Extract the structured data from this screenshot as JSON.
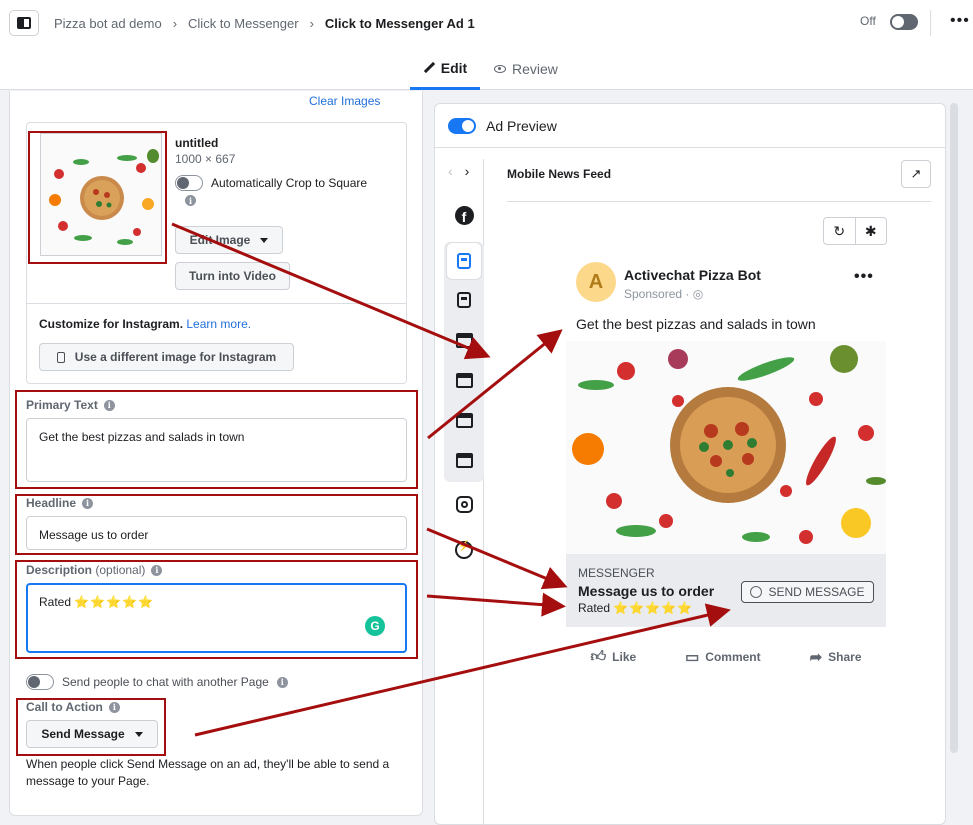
{
  "header": {
    "breadcrumbs": [
      "Pizza bot ad demo",
      "Click to Messenger",
      "Click to Messenger Ad 1"
    ],
    "status_label": "Off",
    "more_icon": "more-horizontal-icon"
  },
  "tabs": [
    {
      "label": "Edit",
      "icon": "pencil-icon",
      "active": true
    },
    {
      "label": "Review",
      "icon": "eye-icon",
      "active": false
    }
  ],
  "editor": {
    "clear_images": "Clear Images",
    "image": {
      "name": "untitled",
      "dimensions": "1000 × 667",
      "crop_label": "Automatically Crop to Square",
      "edit_button": "Edit Image",
      "video_button": "Turn into Video"
    },
    "instagram": {
      "title": "Customize for Instagram.",
      "link": "Learn more.",
      "button": "Use a different image for Instagram"
    },
    "primary_text": {
      "label": "Primary Text",
      "value": "Get the best pizzas and salads in town"
    },
    "headline": {
      "label": "Headline",
      "value": "Message us to order"
    },
    "description": {
      "label": "Description",
      "optional": "(optional)",
      "value": "Rated",
      "stars": "⭐⭐⭐⭐⭐"
    },
    "chat_toggle_label": "Send people to chat with another Page",
    "cta": {
      "label": "Call to Action",
      "value": "Send Message",
      "help": "When people click Send Message on an ad, they'll be able to send a message to your Page."
    }
  },
  "preview": {
    "title": "Ad Preview",
    "placement": "Mobile News Feed",
    "ad": {
      "avatar_letter": "A",
      "page_name": "Activechat Pizza Bot",
      "sponsored": "Sponsored · ",
      "text": "Get the best pizzas and salads in town",
      "source": "MESSENGER",
      "headline": "Message us to order",
      "description": "Rated",
      "stars": "⭐⭐⭐⭐⭐",
      "cta": "SEND MESSAGE",
      "actions": [
        "Like",
        "Comment",
        "Share"
      ]
    }
  },
  "colors": {
    "accent": "#1877f2",
    "highlight": "#a50e0e",
    "link": "#216fdb"
  }
}
